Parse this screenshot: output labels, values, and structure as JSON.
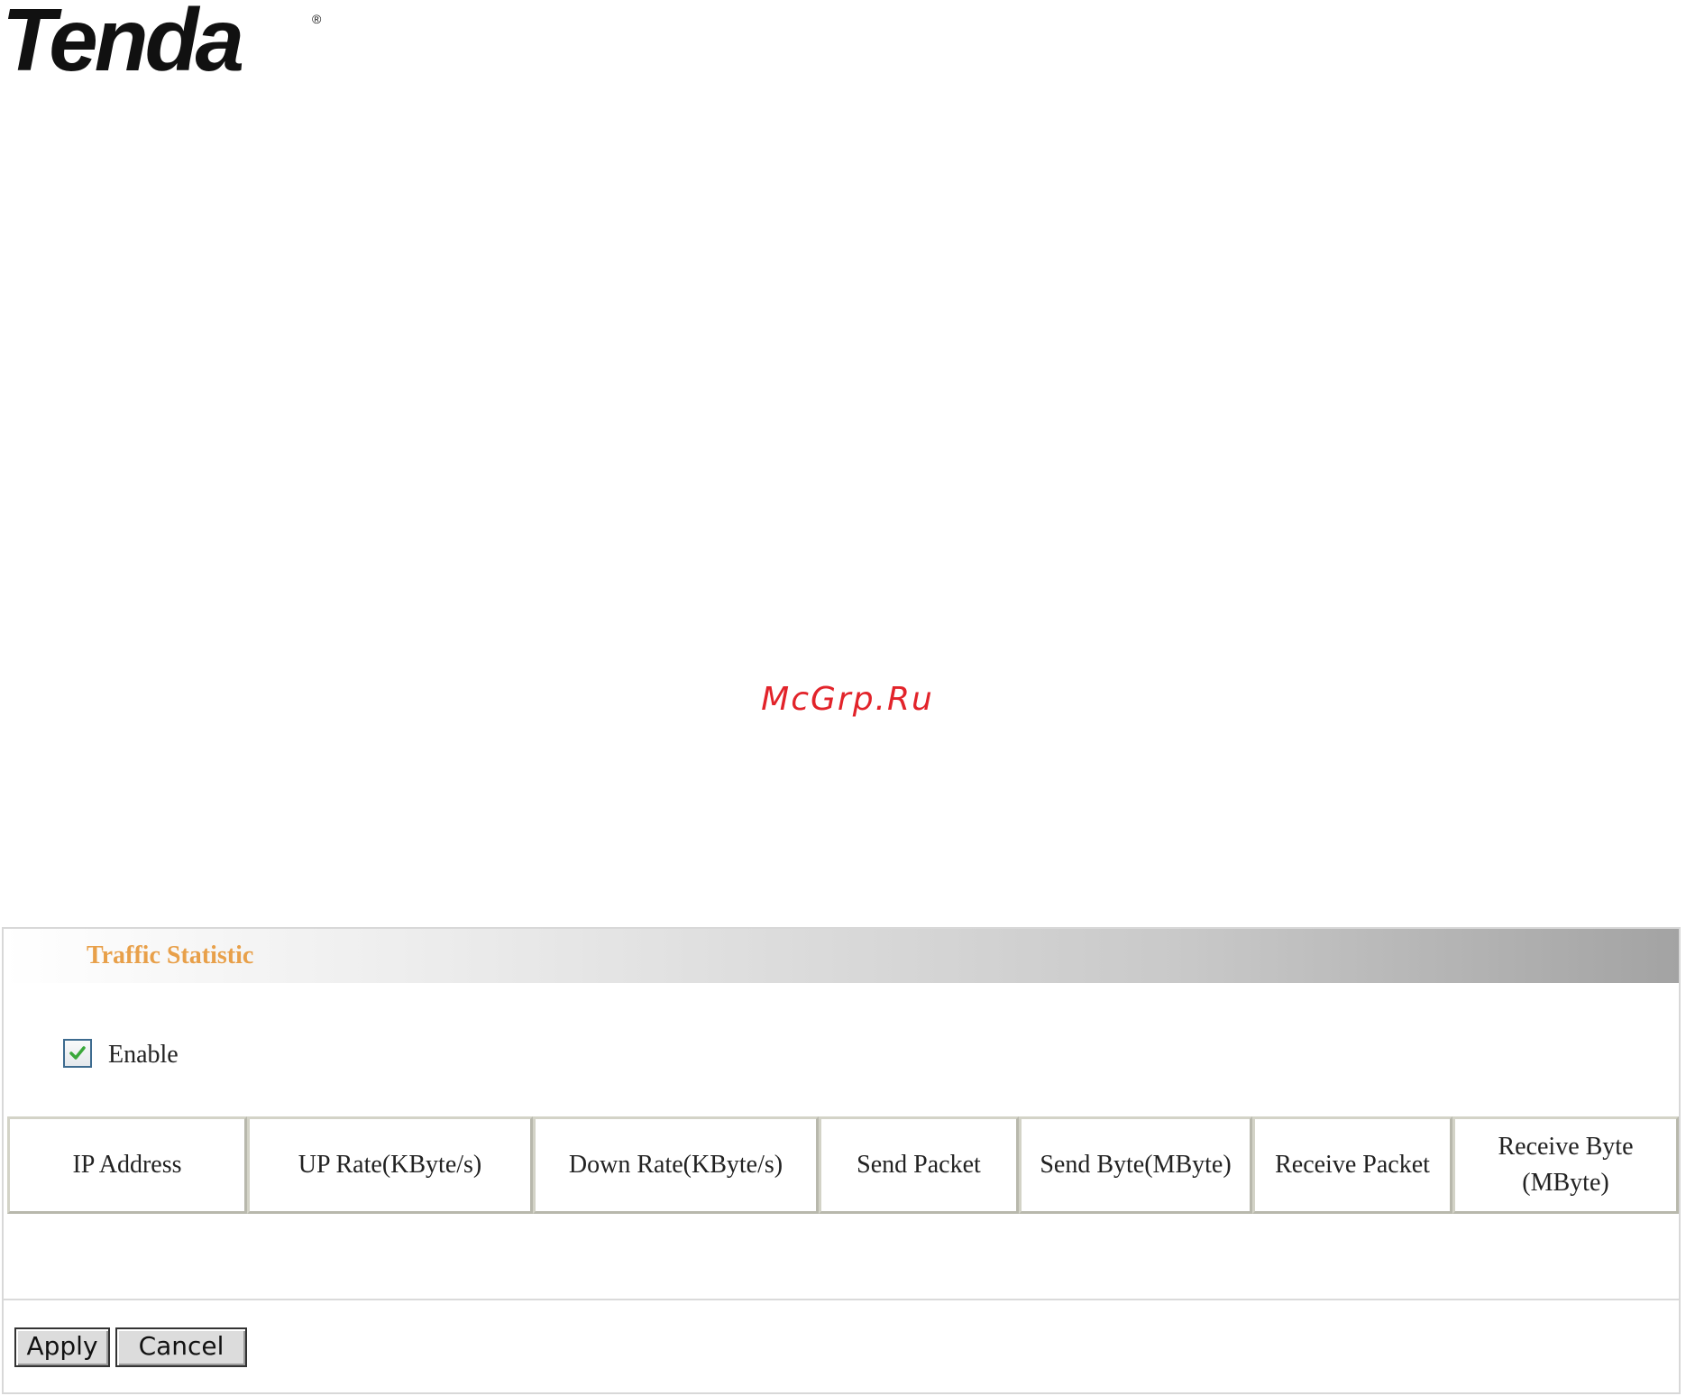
{
  "brand": {
    "logo_text": "Tenda",
    "registered_mark": "®"
  },
  "watermark": "McGrp.Ru",
  "panel": {
    "title": "Traffic Statistic",
    "enable_label": "Enable",
    "enable_checked": true,
    "columns": [
      "IP Address",
      "UP Rate(KByte/s)",
      "Down Rate(KByte/s)",
      "Send Packet",
      "Send Byte(MByte)",
      "Receive Packet",
      "Receive Byte (MByte)"
    ],
    "rows": [],
    "buttons": {
      "apply": "Apply",
      "cancel": "Cancel"
    }
  },
  "colors": {
    "title": "#e8a04a",
    "watermark": "#e2232a",
    "check": "#3aa83a"
  }
}
